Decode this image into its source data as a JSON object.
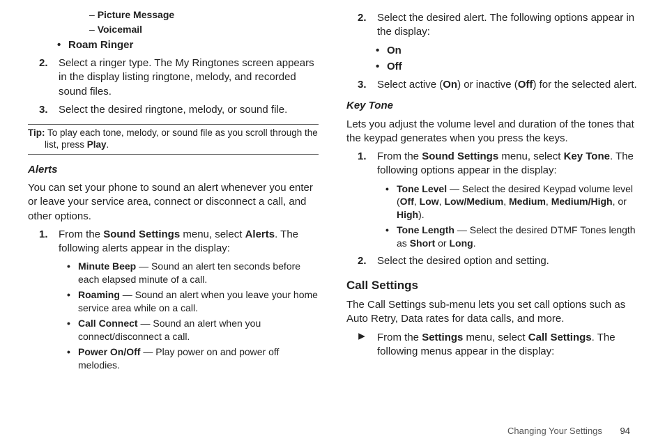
{
  "left": {
    "dash_items": [
      "Picture Message",
      "Voicemail"
    ],
    "roam_ringer": "Roam Ringer",
    "step2": {
      "num": "2.",
      "text": "Select a ringer type. The My Ringtones screen appears in the display listing ringtone, melody, and recorded sound files."
    },
    "step3": {
      "num": "3.",
      "text": "Select the desired ringtone, melody, or sound file."
    },
    "tip": {
      "label": "Tip:",
      "text_pre": "To play each tone, melody, or sound file as you scroll through the list, press ",
      "play": "Play",
      "text_post": "."
    },
    "alerts_h": "Alerts",
    "alerts_p": "You can set your phone to sound an alert whenever you enter or leave your service area, connect or disconnect a call, and other options.",
    "alerts_step1": {
      "num": "1.",
      "pre": "From the ",
      "b1": "Sound Settings",
      "mid": " menu, select ",
      "b2": "Alerts",
      "post": ". The following alerts appear in the display:"
    },
    "bullets": [
      {
        "name": "Minute Beep",
        "desc": " — Sound an alert ten seconds before each elapsed minute of a call."
      },
      {
        "name": "Roaming",
        "desc": " — Sound an alert when you leave your home service area while on a call."
      },
      {
        "name": "Call Connect",
        "desc": " — Sound an alert when you connect/disconnect a call."
      },
      {
        "name": "Power On/Off",
        "desc": " — Play power on and power off melodies."
      }
    ]
  },
  "right": {
    "step2": {
      "num": "2.",
      "text": "Select the desired alert. The following options appear in the display:"
    },
    "onoff": [
      "On",
      "Off"
    ],
    "step3": {
      "num": "3.",
      "pre": "Select active (",
      "on": "On",
      "mid": ") or inactive (",
      "off": "Off",
      "post": ") for the selected alert."
    },
    "keytone_h": "Key Tone",
    "keytone_p": "Lets you adjust the volume level and duration of the tones that the keypad generates when you press the keys.",
    "kt_step1": {
      "num": "1.",
      "pre": "From the ",
      "b1": "Sound Settings",
      "mid": " menu, select ",
      "b2": "Key Tone",
      "post": ". The following options appear in the display:"
    },
    "kt_b1": {
      "name": "Tone Level",
      "pre": " — Select the desired Keypad volume level (",
      "opts": [
        "Off",
        "Low",
        "Low/Medium",
        "Medium",
        "Medium/High",
        "High"
      ],
      "post": ")."
    },
    "kt_b2": {
      "name": "Tone Length",
      "pre": " — Select the desired DTMF Tones length as ",
      "o1": "Short",
      "mid": " or ",
      "o2": "Long",
      "post": "."
    },
    "kt_step2": {
      "num": "2.",
      "text": "Select the desired option and setting."
    },
    "cs_h": "Call Settings",
    "cs_p": "The Call Settings sub-menu lets you set call options such as Auto Retry, Data rates for data calls, and more.",
    "cs_arrow": {
      "pre": "From the ",
      "b1": "Settings",
      "mid": " menu, select ",
      "b2": "Call Settings",
      "post": ". The following menus appear in the display:"
    }
  },
  "footer": {
    "section": "Changing Your Settings",
    "page": "94"
  }
}
